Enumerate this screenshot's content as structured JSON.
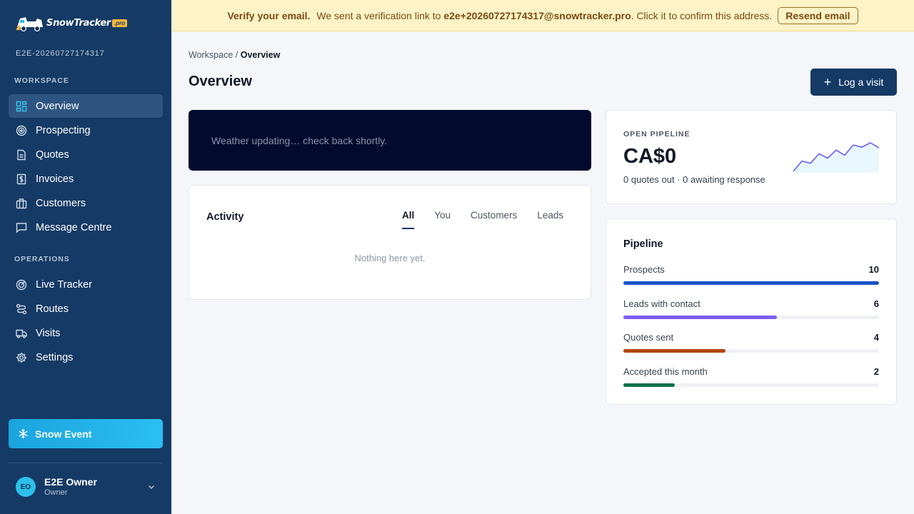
{
  "brand": {
    "name": "SnowTracker",
    "badge": ".pro"
  },
  "workspace_id": "E2E-20260727174317",
  "sidebar": {
    "workspace_label": "WORKSPACE",
    "workspace_items": [
      {
        "label": "Overview",
        "icon": "dashboard-icon",
        "active": true
      },
      {
        "label": "Prospecting",
        "icon": "target-icon"
      },
      {
        "label": "Quotes",
        "icon": "document-icon"
      },
      {
        "label": "Invoices",
        "icon": "dollar-invoice-icon"
      },
      {
        "label": "Customers",
        "icon": "briefcase-icon"
      },
      {
        "label": "Message Centre",
        "icon": "chat-icon"
      }
    ],
    "operations_label": "OPERATIONS",
    "operations_items": [
      {
        "label": "Live Tracker",
        "icon": "radar-icon"
      },
      {
        "label": "Routes",
        "icon": "route-icon"
      },
      {
        "label": "Visits",
        "icon": "truck-icon"
      },
      {
        "label": "Settings",
        "icon": "gear-icon"
      }
    ],
    "snow_event": "Snow Event",
    "user": {
      "initials": "EO",
      "name": "E2E Owner",
      "role": "Owner"
    }
  },
  "banner": {
    "title": "Verify your email.",
    "text_before": "We sent a verification link to",
    "email": "e2e+20260727174317@snowtracker.pro",
    "text_after": ". Click it to confirm this address.",
    "button": "Resend email",
    "bg_color": "#fdf3c7"
  },
  "breadcrumb": {
    "parent": "Workspace",
    "separator": " / ",
    "current": "Overview"
  },
  "page_title": "Overview",
  "log_visit": {
    "label": "Log a visit"
  },
  "weather": {
    "message": "Weather updating… check back shortly."
  },
  "activity": {
    "title": "Activity",
    "tabs": [
      {
        "label": "All",
        "active": true
      },
      {
        "label": "You"
      },
      {
        "label": "Customers"
      },
      {
        "label": "Leads"
      }
    ],
    "empty": "Nothing here yet."
  },
  "open_pipeline": {
    "kicker": "OPEN PIPELINE",
    "amount": "CA$0",
    "quotes_out": "0 quotes out",
    "separator": " · ",
    "awaiting": "0 awaiting response",
    "sparkline": [
      0,
      14,
      11,
      24,
      18,
      29,
      22,
      36,
      33,
      39,
      32
    ],
    "sparkline_color": "#6b5cf0"
  },
  "pipeline": {
    "title": "Pipeline",
    "max": 10,
    "rows": [
      {
        "label": "Prospects",
        "value": 10,
        "color": "#1a55c7"
      },
      {
        "label": "Leads with contact",
        "value": 6,
        "color": "#7d5cf2"
      },
      {
        "label": "Quotes sent",
        "value": 4,
        "color": "#b1460f"
      },
      {
        "label": "Accepted this month",
        "value": 2,
        "color": "#12714a"
      }
    ]
  }
}
